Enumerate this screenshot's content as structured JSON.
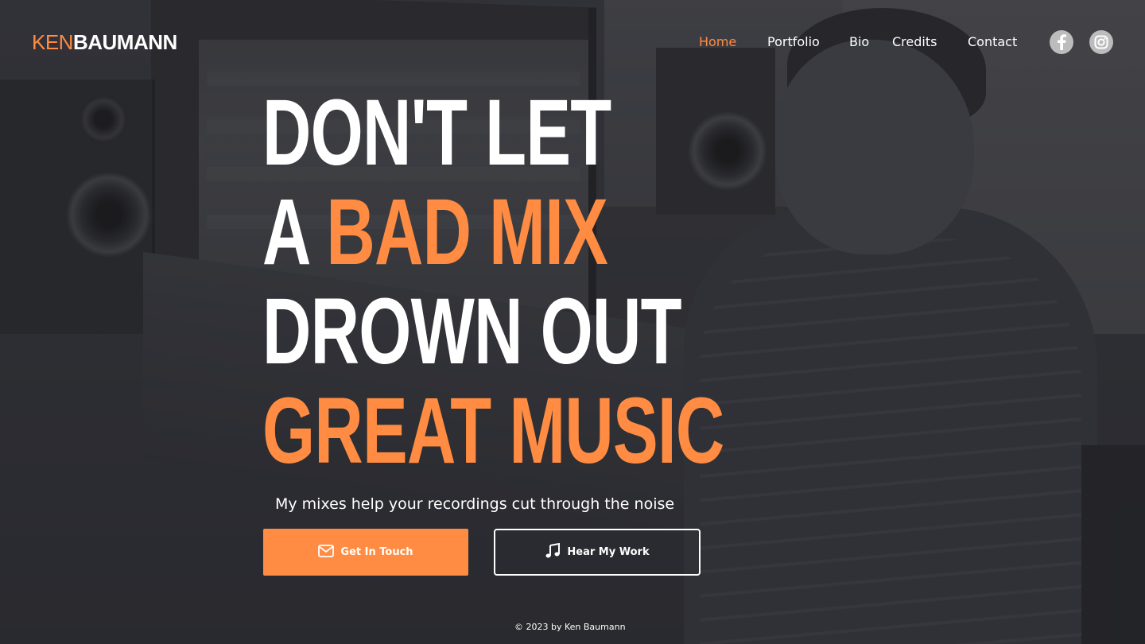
{
  "brand": {
    "first": "KEN",
    "last": "BAUMANN",
    "accent_color": "#ff8c42"
  },
  "nav": {
    "items": [
      {
        "label": "Home",
        "active": true
      },
      {
        "label": "Portfolio",
        "active": false
      },
      {
        "label": "Bio",
        "active": false
      },
      {
        "label": "Credits",
        "active": false
      },
      {
        "label": "Contact",
        "active": false
      }
    ]
  },
  "social": [
    {
      "icon": "facebook-icon"
    },
    {
      "icon": "instagram-icon"
    }
  ],
  "hero": {
    "line1": "DON'T LET",
    "line2_prefix": "A ",
    "line2_accent": "BAD MIX",
    "line3": "DROWN OUT",
    "line4": "GREAT MUSIC",
    "subtitle": "My mixes help your recordings cut through the noise"
  },
  "buttons": {
    "primary": {
      "label": "Get In Touch",
      "icon": "envelope-icon"
    },
    "secondary": {
      "label": "Hear My Work",
      "icon": "music-note-icon"
    }
  },
  "footer": {
    "copyright": "© 2023 by Ken Baumann"
  }
}
